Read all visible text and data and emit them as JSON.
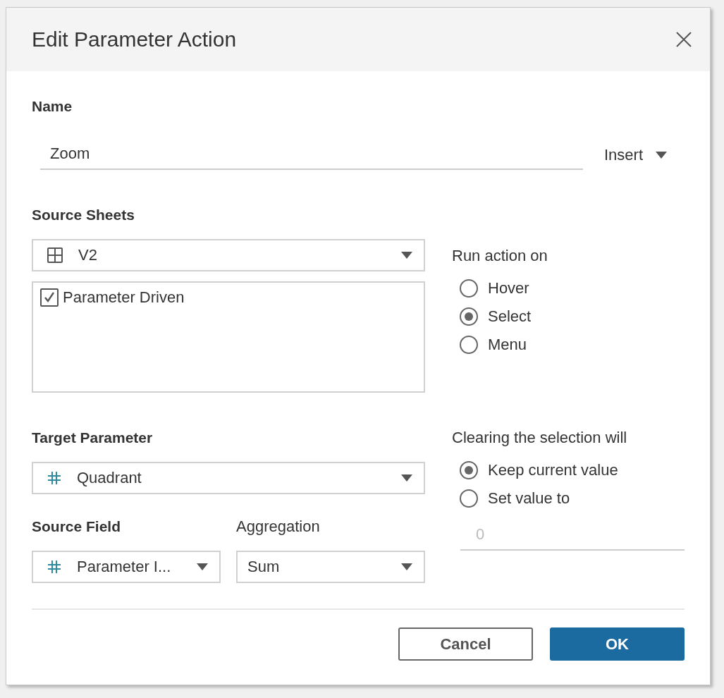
{
  "dialog": {
    "title": "Edit Parameter Action"
  },
  "name": {
    "label": "Name",
    "value": "Zoom",
    "insert_button": "Insert"
  },
  "source_sheets": {
    "label": "Source Sheets",
    "dropdown": "V2",
    "sheets": [
      {
        "label": "Parameter Driven",
        "checked": true
      }
    ]
  },
  "run_action_on": {
    "label": "Run action on",
    "options": [
      {
        "label": "Hover",
        "selected": false
      },
      {
        "label": "Select",
        "selected": true
      },
      {
        "label": "Menu",
        "selected": false
      }
    ]
  },
  "target_parameter": {
    "label": "Target Parameter",
    "dropdown": "Quadrant"
  },
  "source_field": {
    "label": "Source Field",
    "dropdown": "Parameter I..."
  },
  "aggregation": {
    "label": "Aggregation",
    "dropdown": "Sum"
  },
  "clearing": {
    "label": "Clearing the selection will",
    "options": [
      {
        "label": "Keep current value",
        "selected": true
      },
      {
        "label": "Set value to",
        "selected": false
      }
    ],
    "value_field": {
      "placeholder": "0"
    }
  },
  "buttons": [
    {
      "label": "Cancel",
      "kind": "secondary"
    },
    {
      "label": "OK",
      "kind": "primary"
    }
  ]
}
